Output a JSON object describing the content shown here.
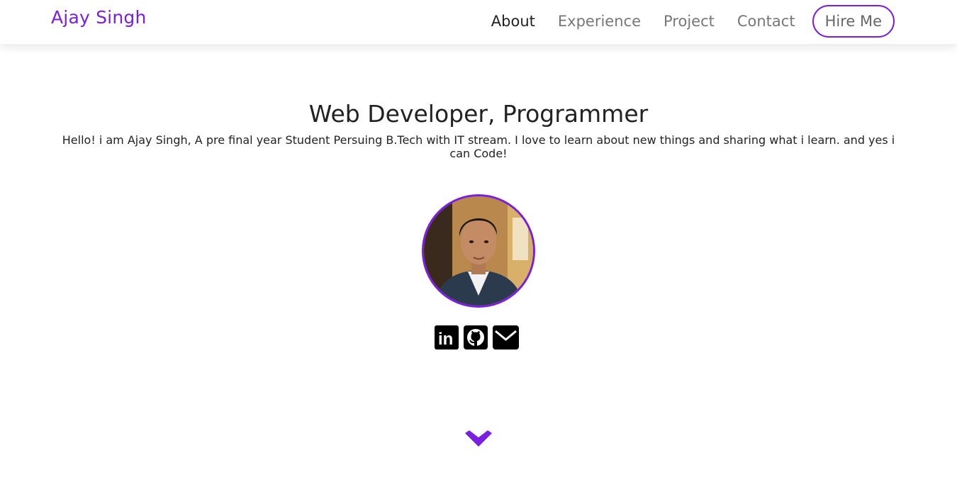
{
  "nav": {
    "brand": "Ajay Singh",
    "links": [
      {
        "label": "About",
        "active": true
      },
      {
        "label": "Experience",
        "active": false
      },
      {
        "label": "Project",
        "active": false
      },
      {
        "label": "Contact",
        "active": false
      }
    ],
    "hire_label": "Hire Me"
  },
  "hero": {
    "title": "Web Developer, Programmer",
    "text": "Hello! i am Ajay Singh, A pre final year Student Persuing B.Tech with IT stream. I love to learn about new things and sharing what i learn. and yes i can Code!"
  },
  "socials": [
    {
      "icon": "linkedin-icon",
      "label": "in"
    },
    {
      "icon": "github-icon"
    },
    {
      "icon": "mail-icon"
    }
  ],
  "colors": {
    "accent": "#7a1fe0",
    "text": "#222222",
    "nav_inactive": "#777777",
    "background": "#ffffff"
  },
  "icons": {
    "scroll": "chevron-down-icon"
  }
}
